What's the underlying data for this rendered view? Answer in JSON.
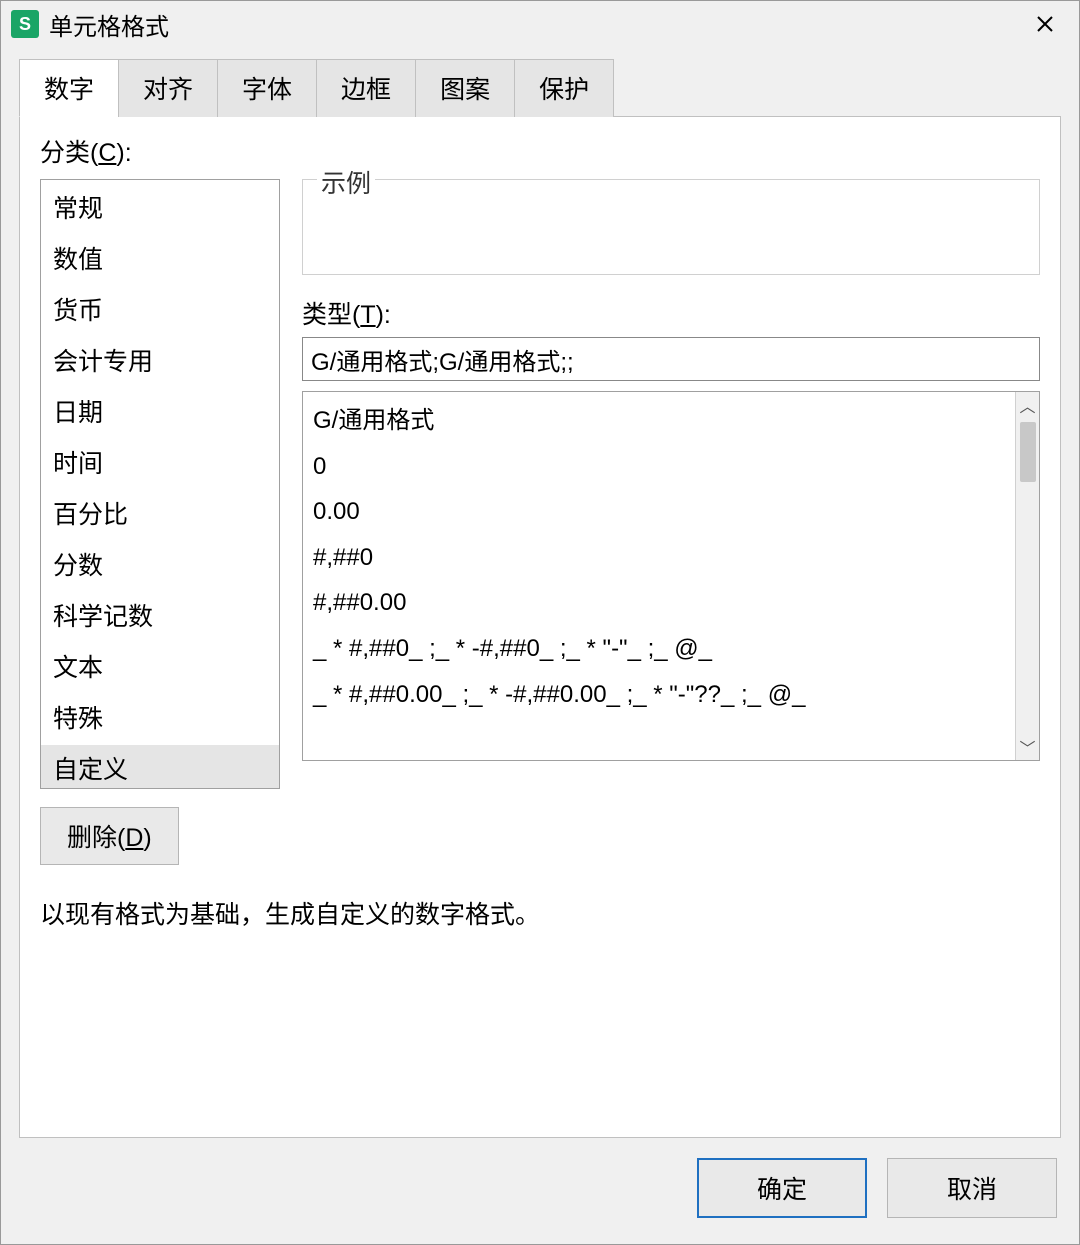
{
  "window": {
    "title": "单元格格式",
    "app_icon_letter": "S"
  },
  "tabs": [
    "数字",
    "对齐",
    "字体",
    "边框",
    "图案",
    "保护"
  ],
  "active_tab_index": 0,
  "labels": {
    "category_prefix": "分类(",
    "category_hotkey": "C",
    "category_suffix": "):",
    "example": "示例",
    "type_prefix": "类型(",
    "type_hotkey": "T",
    "type_suffix": "):",
    "delete_prefix": "删除(",
    "delete_hotkey": "D",
    "delete_suffix": ")",
    "hint": "以现有格式为基础，生成自定义的数字格式。",
    "ok": "确定",
    "cancel": "取消"
  },
  "categories": [
    "常规",
    "数值",
    "货币",
    "会计专用",
    "日期",
    "时间",
    "百分比",
    "分数",
    "科学记数",
    "文本",
    "特殊",
    "自定义"
  ],
  "selected_category_index": 11,
  "type_value": "G/通用格式;G/通用格式;;",
  "format_list": [
    "G/通用格式",
    "0",
    "0.00",
    "#,##0",
    "#,##0.00",
    "_ * #,##0_ ;_ * -#,##0_ ;_ * \"-\"_ ;_ @_",
    "_ * #,##0.00_ ;_ * -#,##0.00_ ;_ * \"-\"??_ ;_ @_"
  ]
}
